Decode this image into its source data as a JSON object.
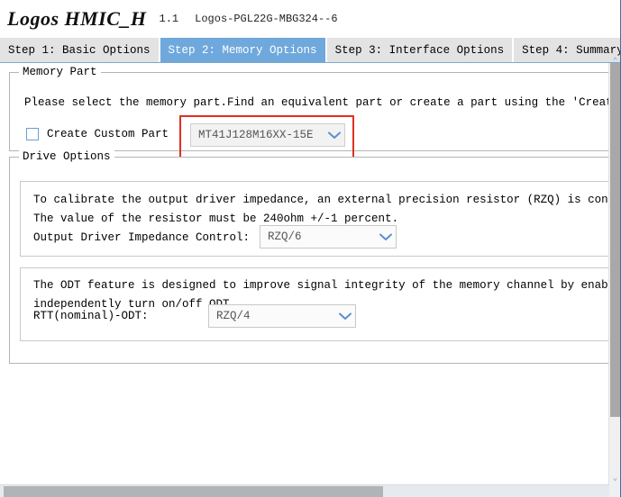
{
  "titlebar": {
    "app_name": "Logos HMIC_H",
    "version": "1.1",
    "device": "Logos-PGL22G-MBG324--6"
  },
  "tabs": [
    {
      "label": "Step 1: Basic Options",
      "active": false
    },
    {
      "label": "Step 2: Memory Options",
      "active": true
    },
    {
      "label": "Step 3: Interface Options",
      "active": false
    },
    {
      "label": "Step 4: Summary",
      "active": false
    }
  ],
  "memory_part": {
    "group_title": "Memory Part",
    "description": "Please select the memory part.Find an equivalent part or create a part using the 'Create Custo",
    "checkbox_label": "Create Custom Part",
    "checkbox_checked": false,
    "part_combo": {
      "value": "MT41J128M16XX-15E",
      "enabled": false
    }
  },
  "drive_options": {
    "group_title": "Drive Options",
    "impedance_panel": {
      "line1": "To calibrate the output driver impedance, an external precision resistor (RZQ) is connected b",
      "line2": "The value of the resistor must be 240ohm +/-1 percent.",
      "label": "Output Driver Impedance Control:",
      "combo_value": "RZQ/6"
    },
    "odt_panel": {
      "line1": "The ODT feature is designed to improve signal integrity of the memory channel by enabling th",
      "line2": "independently turn on/off ODT.",
      "label": "RTT(nominal)-ODT:",
      "combo_value": "RZQ/4"
    }
  },
  "scrollbars": {
    "vertical_arrow_up": "⌃",
    "vertical_arrow_down": "⌄",
    "horizontal_arrow_right": "›"
  },
  "colors": {
    "tab_active_bg": "#6fa8dc",
    "tab_inactive_bg": "#e3e3e3",
    "highlight_red": "#e03020",
    "combo_arrow_blue": "#5b8fd0",
    "checkbox_border": "#6b9fd4"
  }
}
